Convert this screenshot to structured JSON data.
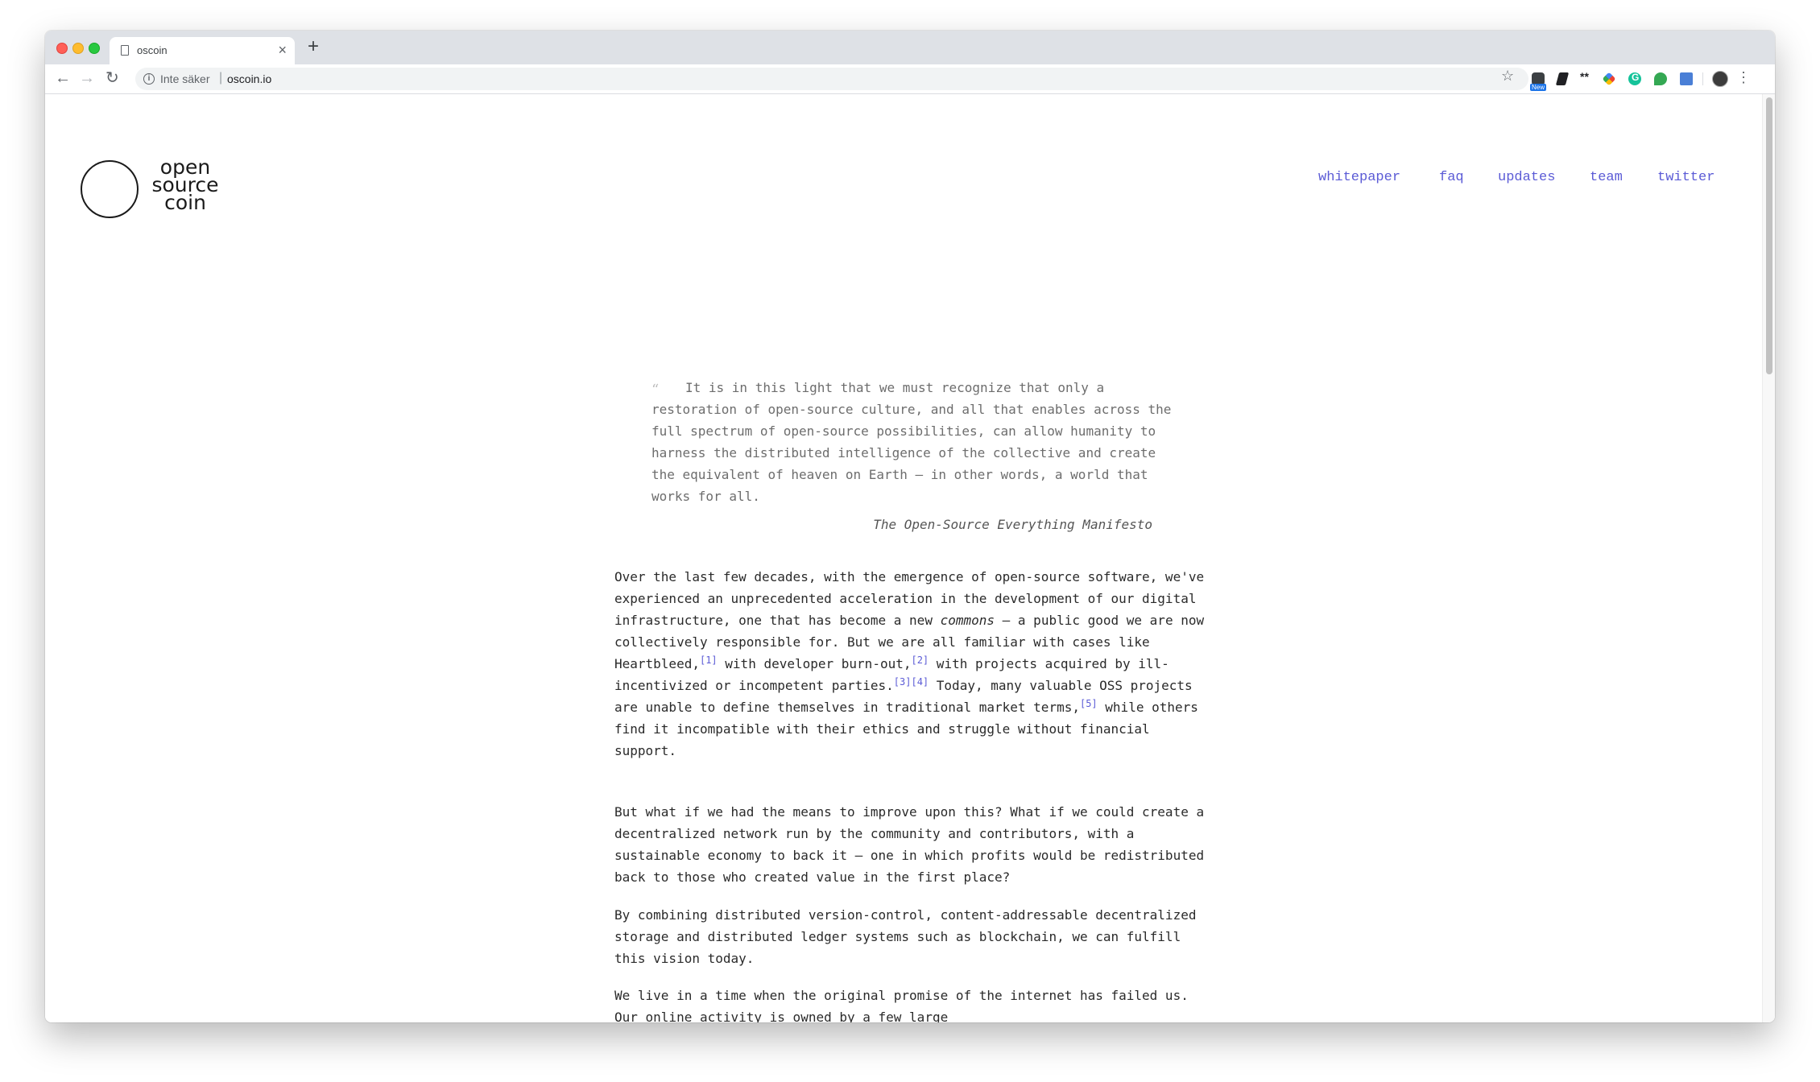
{
  "browser": {
    "tab_title": "oscoin",
    "tab_close": "×",
    "new_tab": "+",
    "security_label": "Inte säker",
    "url": "oscoin.io",
    "extension_badge": "New"
  },
  "site": {
    "logo_lines": [
      "open",
      "source",
      "coin"
    ],
    "nav": [
      "whitepaper",
      "faq",
      "updates",
      "team",
      "twitter"
    ],
    "link_color": "#5b5bd6"
  },
  "quote": {
    "mark": "“",
    "text": "It is in this light that we must recognize that only a restoration of open-source culture, and all that enables across the full spectrum of open-source possibilities, can allow humanity to harness the distributed intelligence of the collective and create the equivalent of heaven on Earth — in other words, a world that works for all.",
    "source": "The Open-Source Everything Manifesto"
  },
  "paragraphs": {
    "p1": {
      "a": "Over the last few decades, with the emergence of open-source software, we've experienced an unprecedented acceleration in the development of our digital infrastructure, one that has become a new ",
      "em": "commons",
      "b": " — a public good we are now collectively responsible for. But we are all familiar with cases like Heartbleed,",
      "ref1": "[1]",
      "c": " with developer burn-out,",
      "ref2": "[2]",
      "d": " with projects acquired by ill-incentivized or incompetent parties.",
      "ref3": "[3]",
      "ref4": "[4]",
      "e": " Today, many valuable OSS projects are unable to define themselves in traditional market terms,",
      "ref5": "[5]",
      "f": " while others find it incompatible with their ethics and struggle without financial support."
    },
    "p2": "But what if we had the means to improve upon this? What if we could create a decentralized network run by the community and contributors, with a sustainable economy to back it — one in which profits would be redistributed back to those who created value in the first place?",
    "p3": "By combining distributed version-control, content-addressable decentralized storage and distributed ledger systems such as blockchain, we can fulfill this vision today.",
    "p4": "We live in a time when the original promise of the internet has failed us. Our online activity is owned by a few large"
  }
}
